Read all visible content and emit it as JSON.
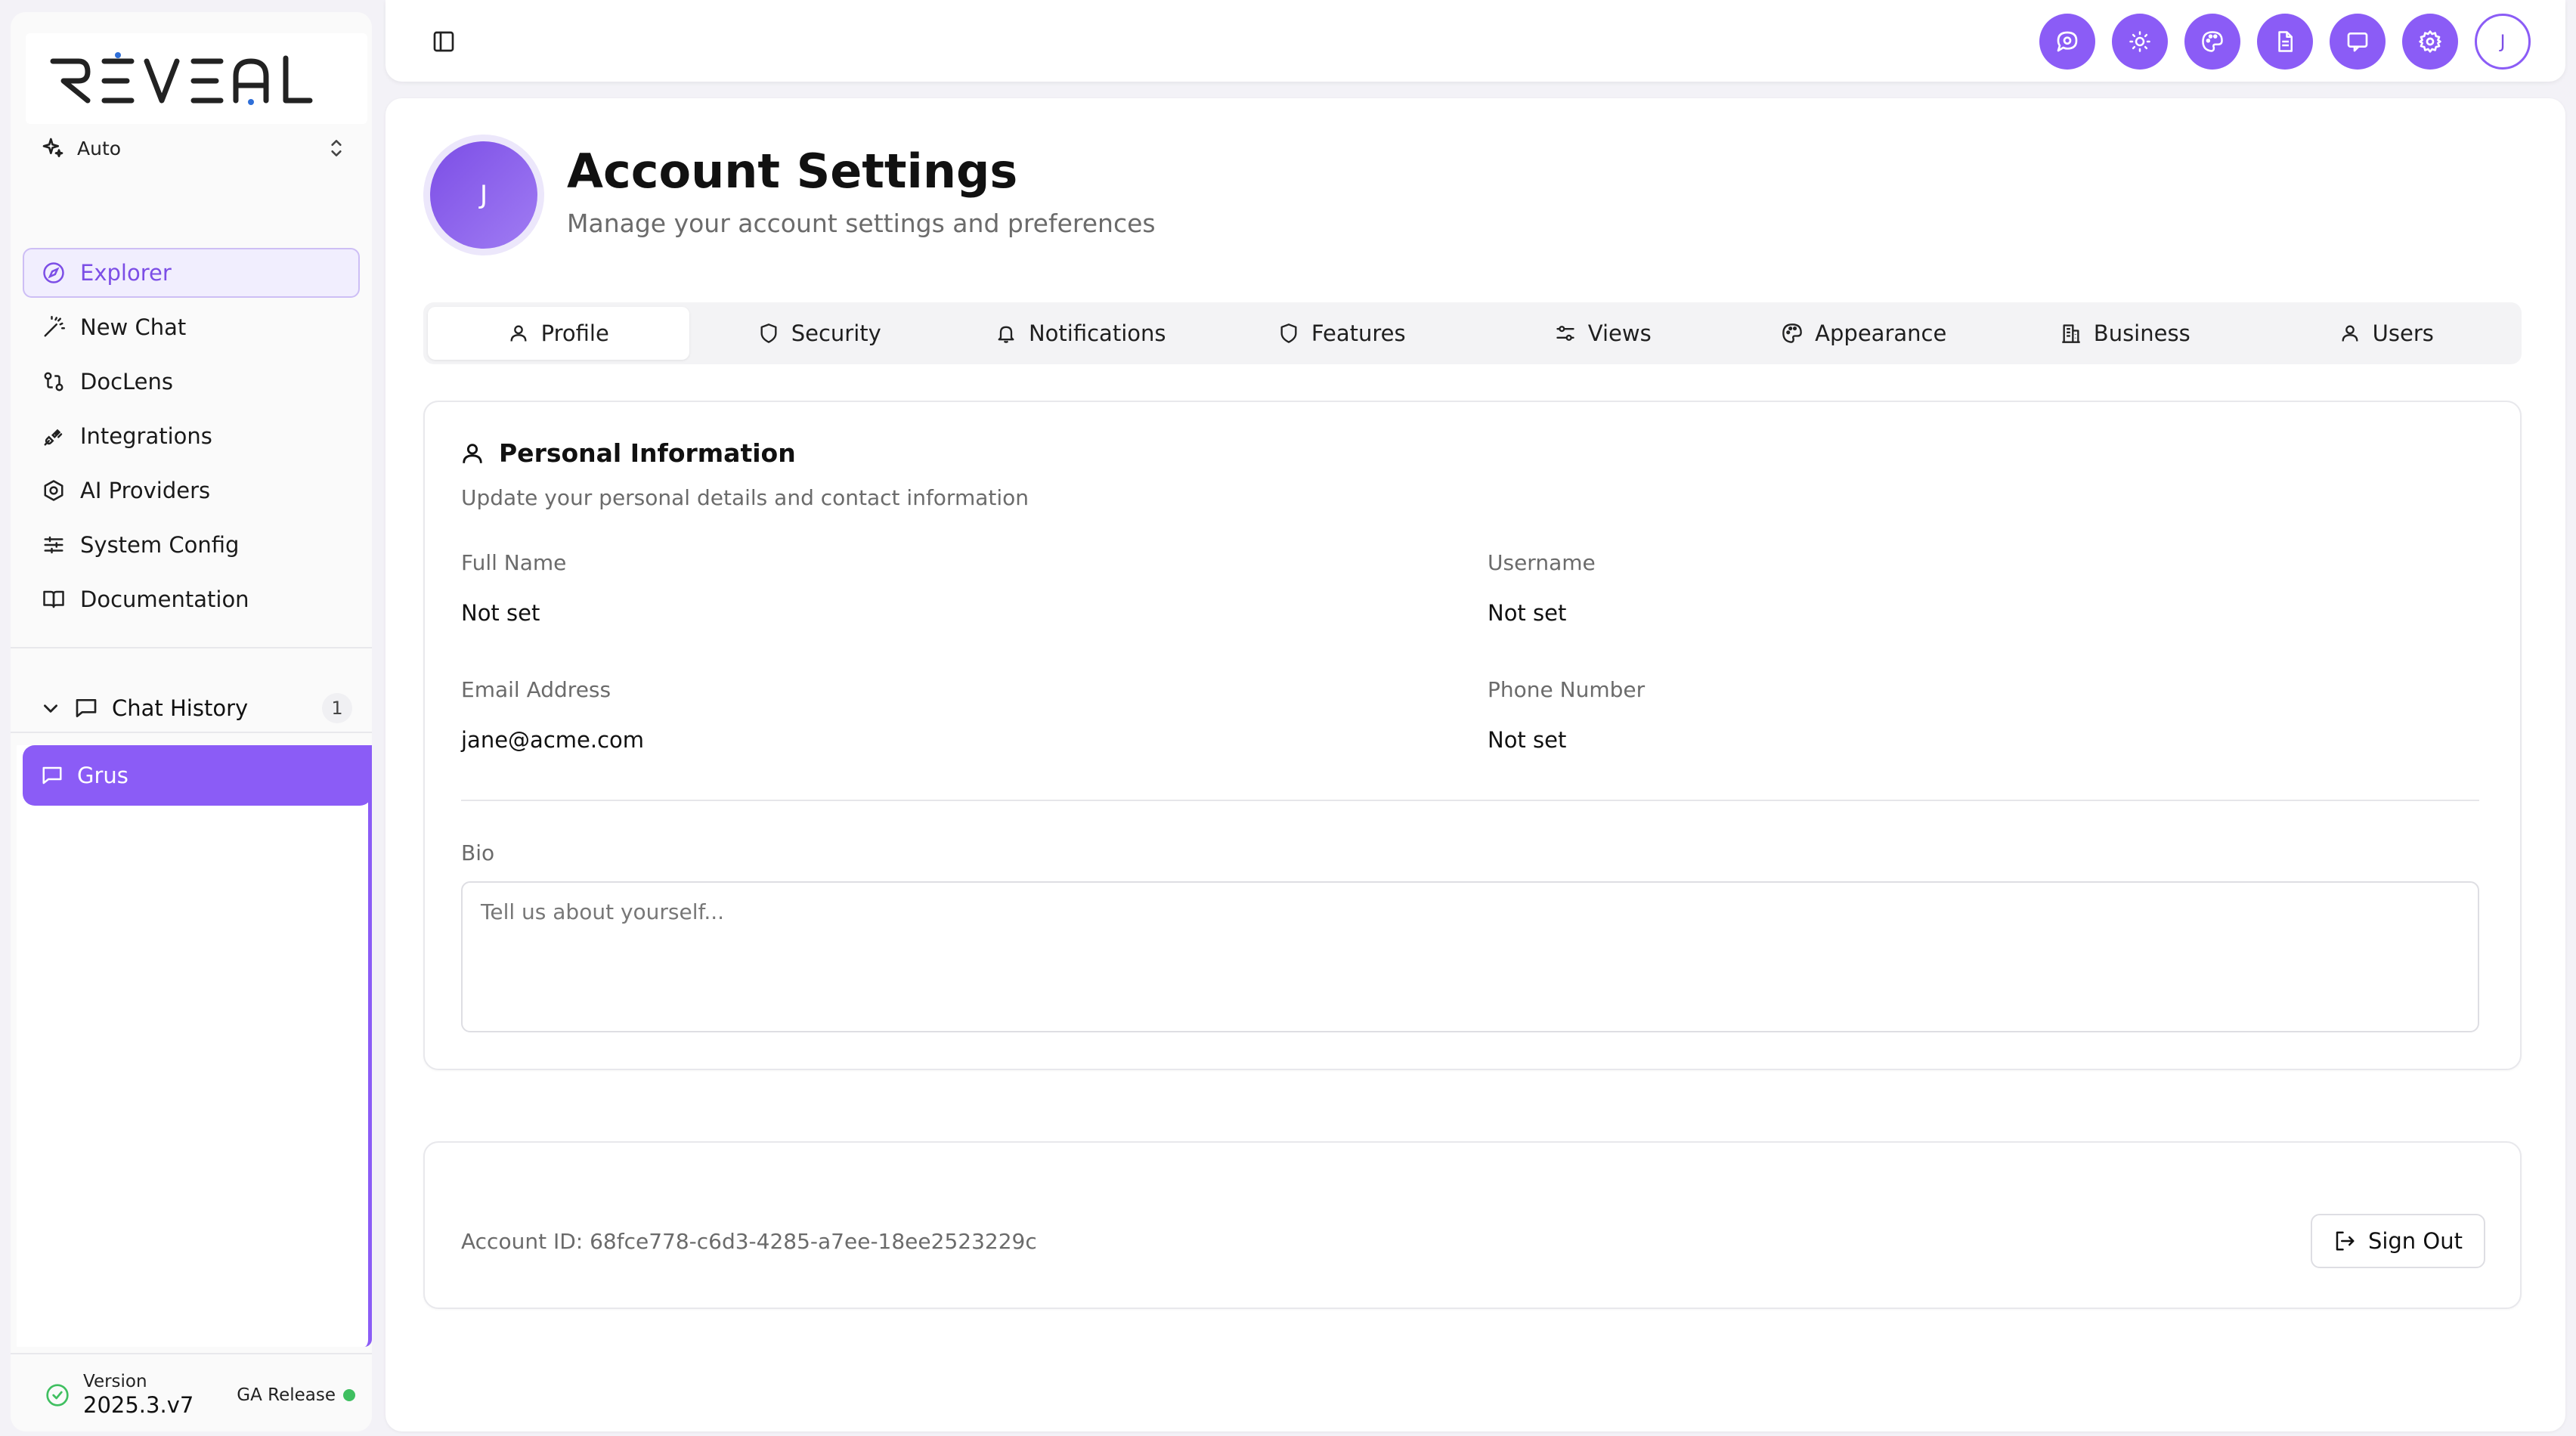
{
  "brand": {
    "logo_text": "REVEAL",
    "accent": "#8b5cf6"
  },
  "sidebar": {
    "model_select": {
      "icon": "sparkles-icon",
      "value": "Auto"
    },
    "nav": [
      {
        "label": "Explorer",
        "icon": "compass-icon",
        "active": true
      },
      {
        "label": "New Chat",
        "icon": "magic-wand-icon"
      },
      {
        "label": "DocLens",
        "icon": "git-compare-icon"
      },
      {
        "label": "Integrations",
        "icon": "plug-icon"
      },
      {
        "label": "AI Providers",
        "icon": "hexagon-icon"
      },
      {
        "label": "System Config",
        "icon": "sliders-icon"
      },
      {
        "label": "Documentation",
        "icon": "book-icon"
      }
    ],
    "chat_history": {
      "label": "Chat History",
      "count": "1",
      "items": [
        {
          "label": "Grus"
        }
      ]
    },
    "version": {
      "label": "Version",
      "number": "2025.3.v7",
      "release": "GA Release",
      "status_color": "#3fbf60"
    }
  },
  "topbar": {
    "icons": [
      "chat-bubble-icon",
      "sun-icon",
      "palette-icon",
      "document-icon",
      "message-square-icon",
      "settings-gear-icon"
    ],
    "avatar_initial": "J"
  },
  "page": {
    "avatar_initial": "J",
    "title": "Account Settings",
    "subtitle": "Manage your account settings and preferences"
  },
  "tabs": [
    {
      "label": "Profile",
      "icon": "user-icon",
      "active": true
    },
    {
      "label": "Security",
      "icon": "shield-icon"
    },
    {
      "label": "Notifications",
      "icon": "bell-icon"
    },
    {
      "label": "Features",
      "icon": "shield-outline-icon"
    },
    {
      "label": "Views",
      "icon": "views-sliders-icon"
    },
    {
      "label": "Appearance",
      "icon": "palette-icon"
    },
    {
      "label": "Business",
      "icon": "building-icon"
    },
    {
      "label": "Users",
      "icon": "users-icon"
    }
  ],
  "personal_info": {
    "title": "Personal Information",
    "subtitle": "Update your personal details and contact information",
    "full_name": {
      "label": "Full Name",
      "value": "Not set"
    },
    "username": {
      "label": "Username",
      "value": "Not set"
    },
    "email": {
      "label": "Email Address",
      "value": "jane@acme.com"
    },
    "phone": {
      "label": "Phone Number",
      "value": "Not set"
    },
    "bio": {
      "label": "Bio",
      "placeholder": "Tell us about yourself..."
    }
  },
  "account": {
    "id_text": "Account ID: 68fce778-c6d3-4285-a7ee-18ee2523229c",
    "sign_out_label": "Sign Out"
  }
}
